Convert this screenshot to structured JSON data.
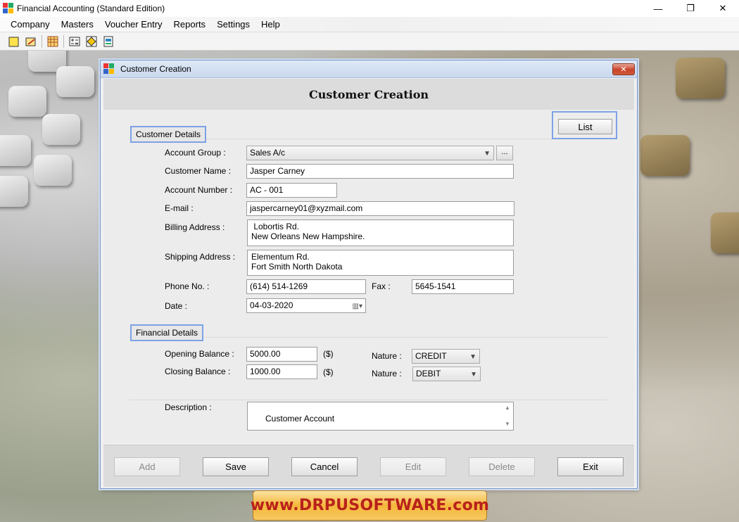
{
  "window": {
    "title": "Financial Accounting (Standard Edition)",
    "minimize": "—",
    "maximize": "❐",
    "close": "✕"
  },
  "menu": [
    {
      "label": "Company"
    },
    {
      "label": "Masters"
    },
    {
      "label": "Voucher Entry"
    },
    {
      "label": "Reports"
    },
    {
      "label": "Settings"
    },
    {
      "label": "Help"
    }
  ],
  "toolbar": {
    "icons": [
      "new-icon",
      "open-icon",
      "table-icon",
      "calc-icon",
      "diamond-icon",
      "export-icon"
    ]
  },
  "dialog": {
    "title": "Customer Creation",
    "heading": "Customer Creation",
    "close": "✕",
    "list_button": "List",
    "customer_section": "Customer Details",
    "financial_section": "Financial Details",
    "labels": {
      "account_group": "Account Group :",
      "customer_name": "Customer Name :",
      "account_number": "Account Number :",
      "email": "E-mail :",
      "billing_address": "Billing Address :",
      "shipping_address": "Shipping Address :",
      "phone": "Phone No. :",
      "fax": "Fax :",
      "date": "Date :",
      "opening_balance": "Opening Balance :",
      "closing_balance": "Closing Balance :",
      "nature": "Nature :",
      "currency": "($)",
      "description": "Description :"
    },
    "values": {
      "account_group": "Sales A/c",
      "browse": "...",
      "customer_name": "Jasper Carney",
      "account_number": "AC - 001",
      "email": "jaspercarney01@xyzmail.com",
      "billing_address": " Lobortis Rd.\nNew Orleans New Hampshire.",
      "shipping_address": "Elementum Rd.\nFort Smith North Dakota",
      "phone": "(614) 514-1269",
      "fax": "5645-1541",
      "date": "04-03-2020",
      "opening_balance": "5000.00",
      "closing_balance": "1000.00",
      "opening_nature": "CREDIT",
      "closing_nature": "DEBIT",
      "description": "Customer Account"
    },
    "buttons": {
      "add": "Add",
      "save": "Save",
      "cancel": "Cancel",
      "edit": "Edit",
      "delete": "Delete",
      "exit": "Exit"
    }
  },
  "watermark": "www.DRPUSOFTWARE.com",
  "colors": {
    "accent_border": "#7da2e6",
    "watermark_text": "#b8211c",
    "watermark_bg": "#f5b63a"
  }
}
